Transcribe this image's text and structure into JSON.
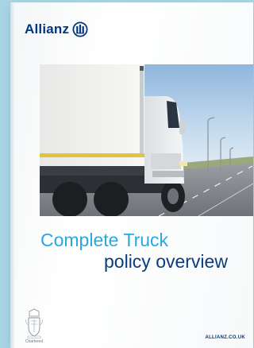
{
  "brand": {
    "name": "Allianz",
    "logo_icon": "allianz-eagle-icon",
    "color": "#003781"
  },
  "cover": {
    "title_line1": "Complete Truck",
    "title_line2": "policy overview",
    "title_color": "#2aa8de",
    "subtitle_color": "#0a3d7a"
  },
  "footer": {
    "crest_label": "Chartered",
    "website": "ALLIANZ.CO.UK"
  },
  "photo": {
    "subject": "white-refrigerated-truck-on-highway"
  }
}
